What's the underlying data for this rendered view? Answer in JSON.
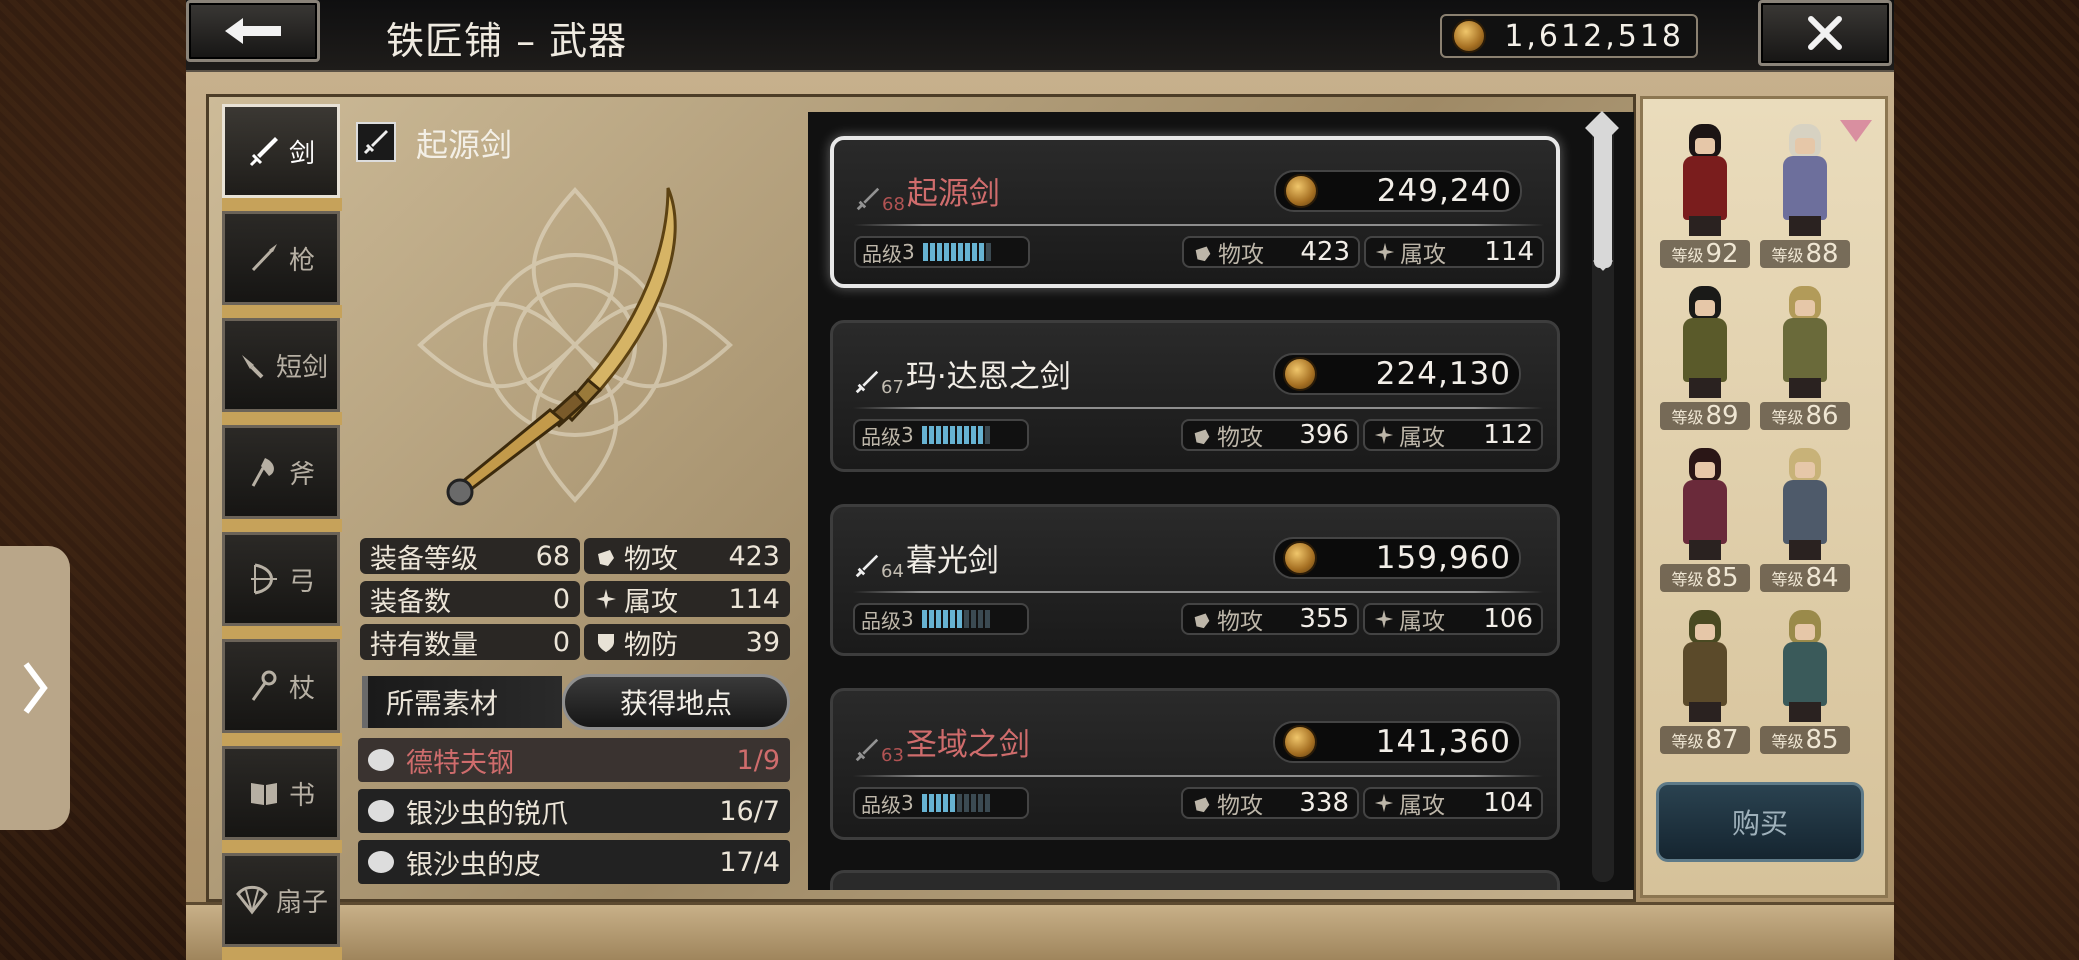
{
  "header": {
    "back_icon": "left-arrow-icon",
    "title": "铁匠铺 – 武器",
    "currency": "1,612,518",
    "close_icon": "x-close-icon"
  },
  "tabs": [
    {
      "label": "剑",
      "icon": "sword-icon",
      "active": true
    },
    {
      "label": "枪",
      "icon": "spear-icon",
      "active": false
    },
    {
      "label": "短剑",
      "icon": "dagger-icon",
      "active": false
    },
    {
      "label": "斧",
      "icon": "axe-icon",
      "active": false
    },
    {
      "label": "弓",
      "icon": "bow-icon",
      "active": false
    },
    {
      "label": "杖",
      "icon": "staff-icon",
      "active": false
    },
    {
      "label": "书",
      "icon": "book-icon",
      "active": false
    },
    {
      "label": "扇子",
      "icon": "fan-icon",
      "active": false
    }
  ],
  "detail": {
    "name": "起源剑",
    "stats_left": [
      {
        "label": "装备等级",
        "value": "68"
      },
      {
        "label": "装备数",
        "value": "0"
      },
      {
        "label": "持有数量",
        "value": "0"
      }
    ],
    "stats_right": [
      {
        "label": "物攻",
        "value": "423",
        "icon": "fist-icon"
      },
      {
        "label": "属攻",
        "value": "114",
        "icon": "magic-icon"
      },
      {
        "label": "物防",
        "value": "39",
        "icon": "shield-icon"
      }
    ],
    "materials_label": "所需素材",
    "location_button": "获得地点",
    "materials": [
      {
        "name": "德特夫钢",
        "count": "1/9",
        "insufficient": true
      },
      {
        "name": "银沙虫的锐爪",
        "count": "16/7",
        "insufficient": false
      },
      {
        "name": "银沙虫的皮",
        "count": "17/4",
        "insufficient": false
      }
    ]
  },
  "weapons": [
    {
      "level": "68",
      "name": "起源剑",
      "price": "249,240",
      "grade_label": "品级",
      "grade": "3",
      "quality": 0.85,
      "atk_label": "物攻",
      "atk": "423",
      "elem_label": "属攻",
      "elem": "114",
      "unavailable": true,
      "selected": true
    },
    {
      "level": "67",
      "name": "玛·达恩之剑",
      "price": "224,130",
      "grade_label": "品级",
      "grade": "3",
      "quality": 0.85,
      "atk_label": "物攻",
      "atk": "396",
      "elem_label": "属攻",
      "elem": "112",
      "unavailable": false,
      "selected": false
    },
    {
      "level": "64",
      "name": "暮光剑",
      "price": "159,960",
      "grade_label": "品级",
      "grade": "3",
      "quality": 0.6,
      "atk_label": "物攻",
      "atk": "355",
      "elem_label": "属攻",
      "elem": "106",
      "unavailable": false,
      "selected": false
    },
    {
      "level": "63",
      "name": "圣域之剑",
      "price": "141,360",
      "grade_label": "品级",
      "grade": "3",
      "quality": 0.5,
      "atk_label": "物攻",
      "atk": "338",
      "elem_label": "属攻",
      "elem": "104",
      "unavailable": true,
      "selected": false
    }
  ],
  "party": [
    {
      "level_label": "等级",
      "level": "92",
      "hair": "#1b1414",
      "cloth": "#7a1d1d"
    },
    {
      "level_label": "等级",
      "level": "88",
      "hair": "#d7d2c2",
      "cloth": "#6d6f9c"
    },
    {
      "level_label": "等级",
      "level": "89",
      "hair": "#1a1a18",
      "cloth": "#5a5a2a"
    },
    {
      "level_label": "等级",
      "level": "86",
      "hair": "#b29b59",
      "cloth": "#6a6a3a"
    },
    {
      "level_label": "等级",
      "level": "85",
      "hair": "#2a1616",
      "cloth": "#6a2a3a"
    },
    {
      "level_label": "等级",
      "level": "84",
      "hair": "#c8b278",
      "cloth": "#4e5a6a"
    },
    {
      "level_label": "等级",
      "level": "87",
      "hair": "#4a4a22",
      "cloth": "#5b4a2a"
    },
    {
      "level_label": "等级",
      "level": "85",
      "hair": "#9a8a4a",
      "cloth": "#3a5a5a"
    }
  ],
  "buy_button": "购买",
  "colors": {
    "insufficient": "#cf6c6c",
    "quality_bar": "#67b3d2",
    "tab_accent": "#c6a25a"
  }
}
